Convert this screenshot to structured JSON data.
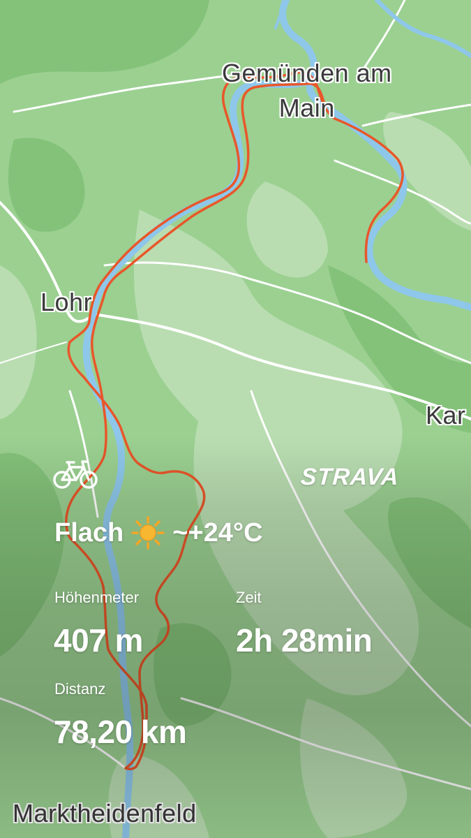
{
  "map": {
    "place_labels": {
      "gemuenden_line1": "Gemünden am",
      "gemuenden_line2": "Main",
      "lohr": "Lohr",
      "karlstadt_partial": "Kar",
      "marktheidenfeld": "Marktheidenfeld"
    },
    "colors": {
      "land": "#9bd091",
      "forest": "#86c47c",
      "open_land": "#b8dcb0",
      "river": "#8ec7ea",
      "road": "#ffffff",
      "route": "#e8572a"
    }
  },
  "activity": {
    "type_icon": "bicycle-icon",
    "brand": "STRAVA",
    "terrain": "Flach",
    "weather_icon": "sun-icon",
    "temperature": "~+24°C",
    "stats": {
      "elevation_label": "Höhenmeter",
      "elevation_value": "407 m",
      "time_label": "Zeit",
      "time_value": "2h 28min",
      "distance_label": "Distanz",
      "distance_value": "78,20 km"
    }
  }
}
